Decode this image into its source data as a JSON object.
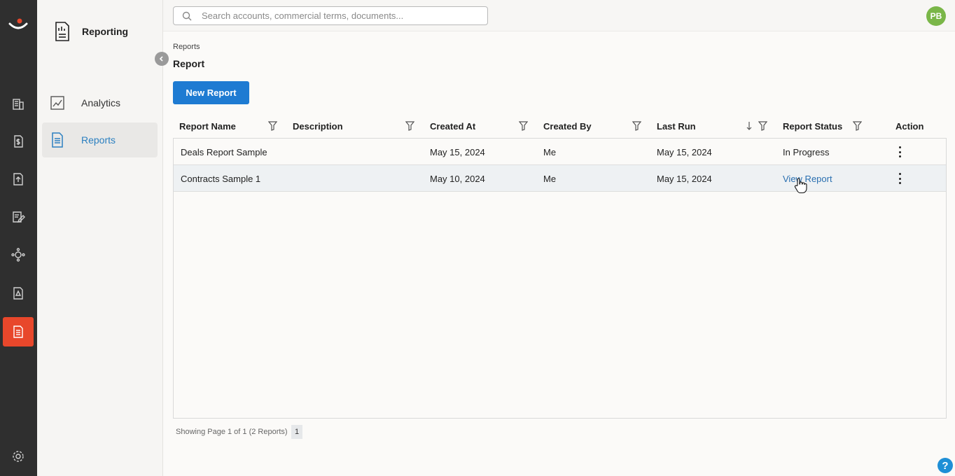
{
  "sidebar": {
    "title": "Reporting",
    "items": [
      {
        "label": "Analytics",
        "icon": "analytics-icon"
      },
      {
        "label": "Reports",
        "icon": "reports-icon",
        "active": true
      }
    ]
  },
  "search": {
    "placeholder": "Search accounts, commercial terms, documents..."
  },
  "user": {
    "initials": "PB"
  },
  "breadcrumb": "Reports",
  "page_title": "Report",
  "new_report_label": "New Report",
  "table": {
    "columns": [
      "Report Name",
      "Description",
      "Created At",
      "Created By",
      "Last Run",
      "Report Status",
      "Action"
    ],
    "rows": [
      {
        "name": "Deals Report Sample",
        "description": "",
        "created_at": "May 15, 2024",
        "created_by": "Me",
        "last_run": "May 15, 2024",
        "status": "In Progress"
      },
      {
        "name": "Contracts Sample 1",
        "description": "",
        "created_at": "May 10, 2024",
        "created_by": "Me",
        "last_run": "May 15, 2024",
        "status": "View Report"
      }
    ]
  },
  "footer": {
    "showing": "Showing Page 1 of 1 (2 Reports)",
    "page": "1"
  },
  "help_label": "?",
  "colors": {
    "accent": "#1e7bd2",
    "rail_active": "#e8472b",
    "rail": "#2f2f2f",
    "avatar": "#7ab648"
  }
}
